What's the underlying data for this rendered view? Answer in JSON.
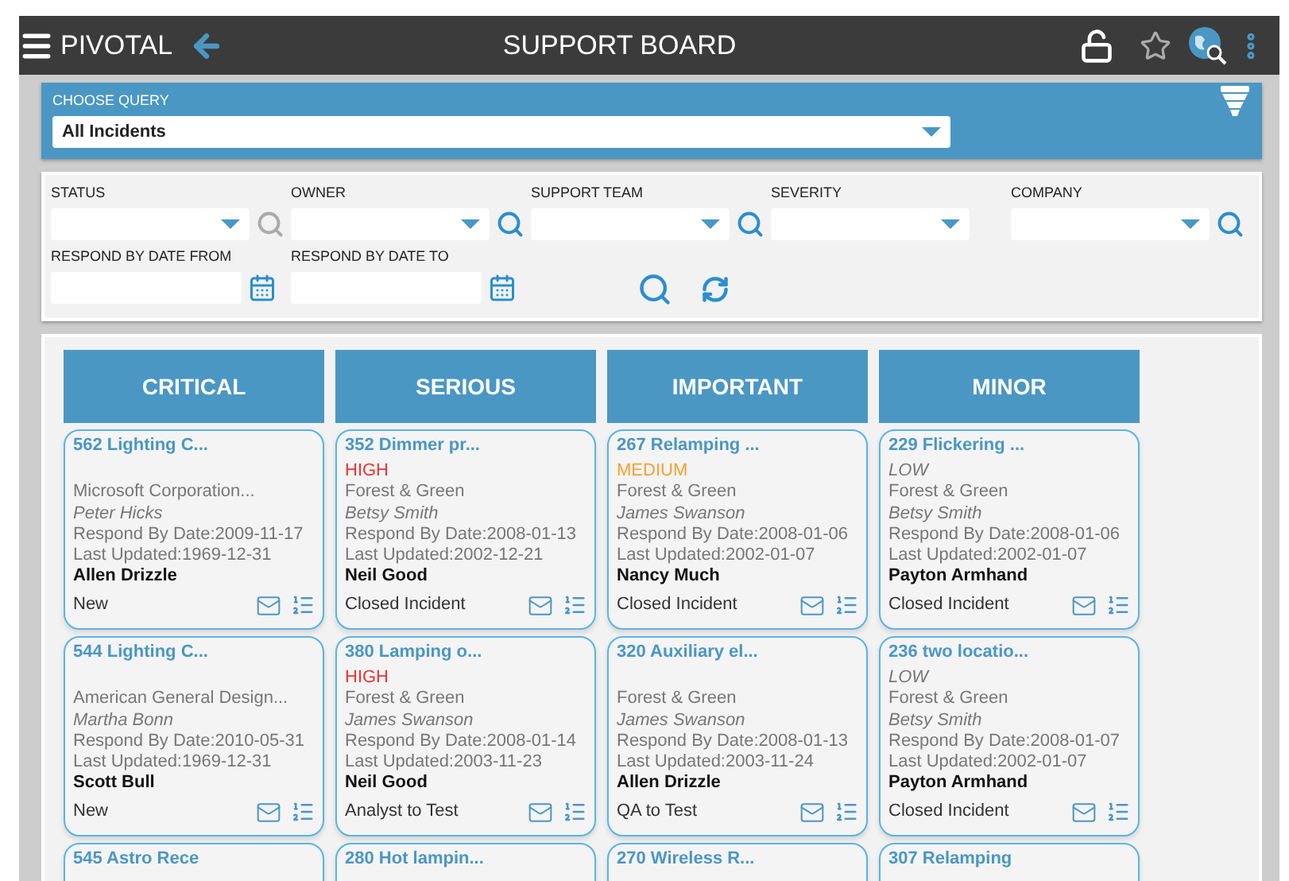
{
  "app": {
    "brand": "PIVOTAL",
    "title": "SUPPORT BOARD"
  },
  "query": {
    "label": "CHOOSE QUERY",
    "value": "All Incidents"
  },
  "filters": [
    {
      "label": "STATUS",
      "kind": "greyed_lookup"
    },
    {
      "label": "OWNER",
      "kind": "lookup"
    },
    {
      "label": "SUPPORT TEAM",
      "kind": "lookup"
    },
    {
      "label": "SEVERITY",
      "kind": "select"
    },
    {
      "label": "COMPANY",
      "kind": "lookup"
    },
    {
      "label": "RESPOND BY DATE FROM",
      "kind": "date"
    },
    {
      "label": "RESPOND BY DATE TO",
      "kind": "date"
    }
  ],
  "columns": [
    {
      "title": "CRITICAL",
      "cards": [
        {
          "title": "562 Lighting C...",
          "company": "Microsoft Corporation...",
          "contact": "Peter Hicks",
          "respond_by": "Respond By Date:2009-11-17",
          "updated": "Last Updated:1969-12-31",
          "owner": "Allen Drizzle",
          "status": "New"
        },
        {
          "title": "544 Lighting C...",
          "company": "American General Design...",
          "contact": "Martha Bonn",
          "respond_by": "Respond By Date:2010-05-31",
          "updated": "Last Updated:1969-12-31",
          "owner": "Scott Bull",
          "status": "New"
        },
        {
          "title": "545 Astro Rece"
        }
      ]
    },
    {
      "title": "SERIOUS",
      "cards": [
        {
          "title": "352 Dimmer pr...",
          "severity": {
            "label": "HIGH",
            "kind": "high"
          },
          "company": "Forest & Green",
          "contact": "Betsy Smith",
          "respond_by": "Respond By Date:2008-01-13",
          "updated": "Last Updated:2002-12-21",
          "owner": "Neil Good",
          "status": "Closed Incident"
        },
        {
          "title": "380 Lamping o...",
          "severity": {
            "label": "HIGH",
            "kind": "high"
          },
          "company": "Forest & Green",
          "contact": "James Swanson",
          "respond_by": "Respond By Date:2008-01-14",
          "updated": "Last Updated:2003-11-23",
          "owner": "Neil Good",
          "status": "Analyst to Test"
        },
        {
          "title": "280 Hot lampin..."
        }
      ]
    },
    {
      "title": "IMPORTANT",
      "cards": [
        {
          "title": "267 Relamping ...",
          "severity": {
            "label": "MEDIUM",
            "kind": "medium"
          },
          "company": "Forest & Green",
          "contact": "James Swanson",
          "respond_by": "Respond By Date:2008-01-06",
          "updated": "Last Updated:2002-01-07",
          "owner": "Nancy Much",
          "status": "Closed Incident"
        },
        {
          "title": "320 Auxiliary el...",
          "company": "Forest & Green",
          "contact": "James Swanson",
          "respond_by": "Respond By Date:2008-01-13",
          "updated": "Last Updated:2003-11-24",
          "owner": "Allen Drizzle",
          "status": "QA to Test"
        },
        {
          "title": "270 Wireless R..."
        }
      ]
    },
    {
      "title": "MINOR",
      "cards": [
        {
          "title": "229 Flickering ...",
          "severity": {
            "label": "LOW",
            "kind": "low"
          },
          "company": "Forest & Green",
          "contact": "Betsy Smith",
          "respond_by": "Respond By Date:2008-01-06",
          "updated": "Last Updated:2002-01-07",
          "owner": "Payton Armhand",
          "status": "Closed Incident"
        },
        {
          "title": "236 two locatio...",
          "severity": {
            "label": "LOW",
            "kind": "low"
          },
          "company": "Forest & Green",
          "contact": "Betsy Smith",
          "respond_by": "Respond By Date:2008-01-07",
          "updated": "Last Updated:2002-01-07",
          "owner": "Payton Armhand",
          "status": "Closed Incident"
        },
        {
          "title": "307 Relamping"
        }
      ]
    }
  ]
}
